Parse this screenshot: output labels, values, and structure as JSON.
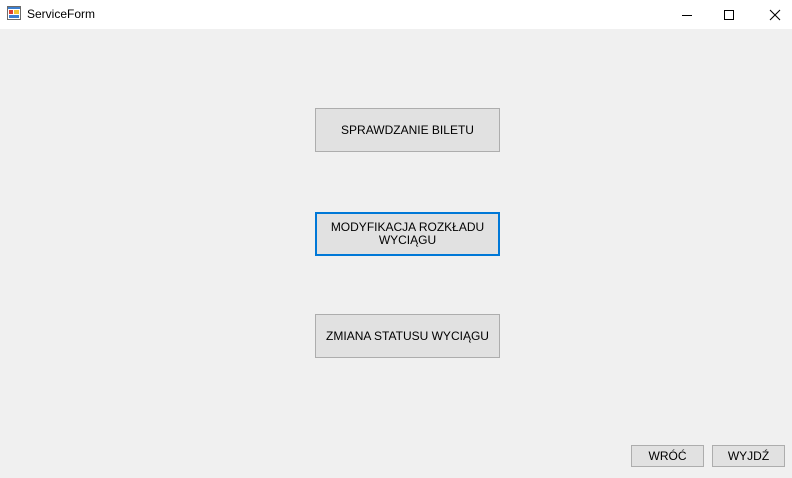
{
  "window": {
    "title": "ServiceForm",
    "app_icon": "winforms-app-icon",
    "controls": {
      "minimize_icon": "minimize-icon",
      "maximize_icon": "maximize-icon",
      "close_icon": "close-icon"
    }
  },
  "main": {
    "check_ticket_label": "SPRAWDZANIE BILETU",
    "modify_schedule_label_line1": "MODYFIKACJA ROZKŁADU",
    "modify_schedule_label_line2": "WYCIĄGU",
    "change_status_label": "ZMIANA STATUSU WYCIĄGU"
  },
  "footer": {
    "back_label": "WRÓĆ",
    "exit_label": "WYJDŹ"
  },
  "colors": {
    "background": "#f0f0f0",
    "titlebar": "#ffffff",
    "button_face": "#e1e1e1",
    "button_border": "#adadad",
    "focus_border": "#0078d7"
  }
}
